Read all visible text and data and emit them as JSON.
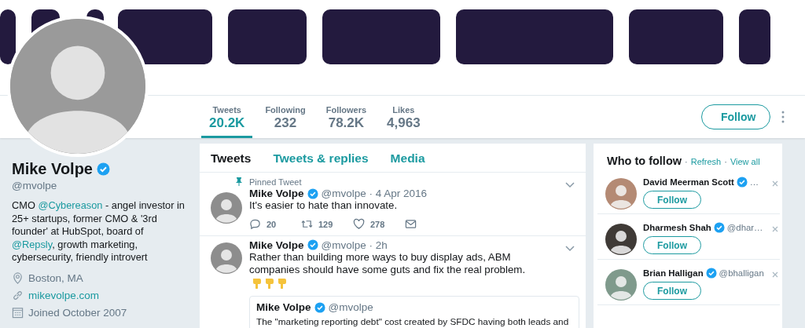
{
  "stats": [
    {
      "label": "Tweets",
      "value": "20.2K",
      "selected": true
    },
    {
      "label": "Following",
      "value": "232",
      "selected": false
    },
    {
      "label": "Followers",
      "value": "78.2K",
      "selected": false
    },
    {
      "label": "Likes",
      "value": "4,963",
      "selected": false
    }
  ],
  "follow_button": "Follow",
  "profile": {
    "name": "Mike Volpe",
    "verified": true,
    "handle": "@mvolpe",
    "bio": [
      {
        "text": "CMO ",
        "kind": "plain"
      },
      {
        "text": "@Cybereason",
        "kind": "link"
      },
      {
        "text": " - angel investor in 25+ startups, former CMO & '3rd founder' at HubSpot, board of ",
        "kind": "plain"
      },
      {
        "text": "@Repsly",
        "kind": "link"
      },
      {
        "text": ", growth marketing, cybersecurity, friendly introvert",
        "kind": "plain"
      }
    ],
    "details": [
      {
        "kind": "location",
        "text": "Boston, MA"
      },
      {
        "kind": "link",
        "text": "mikevolpe.com"
      },
      {
        "kind": "joined",
        "text": "Joined October 2007"
      }
    ]
  },
  "tabs": [
    {
      "label": "Tweets",
      "selected": true
    },
    {
      "label": "Tweets & replies",
      "selected": false
    },
    {
      "label": "Media",
      "selected": false
    }
  ],
  "tweets": [
    {
      "pinned_label": "Pinned Tweet",
      "name": "Mike Volpe",
      "verified": true,
      "meta": "@mvolpe · 4 Apr 2016",
      "text": "It's easier to hate than innovate.",
      "emoji_hands": false,
      "actions": {
        "replies": "20",
        "retweets": "129",
        "likes": "278"
      }
    },
    {
      "name": "Mike Volpe",
      "verified": true,
      "meta": "@mvolpe · 2h",
      "text": "Rather than building more ways to buy display ads, ABM companies should have some guts and fix the real problem.",
      "emoji_hands": true,
      "quote": {
        "name": "Mike Volpe",
        "verified": true,
        "handle": "@mvolpe",
        "text": "The \"marketing reporting debt\" cost created by SFDC having both leads and"
      }
    }
  ],
  "who_to_follow": {
    "title": "Who to follow",
    "links": [
      {
        "sep": "·",
        "label": "Refresh"
      },
      {
        "sep": "·",
        "label": "View all"
      }
    ],
    "items": [
      {
        "name": "David Meerman Scott",
        "verified": true,
        "handle": "…",
        "button": "Follow"
      },
      {
        "name": "Dharmesh Shah",
        "verified": true,
        "handle": "@dhar…",
        "button": "Follow"
      },
      {
        "name": "Brian Halligan",
        "verified": true,
        "handle": "@bhalligan",
        "button": "Follow"
      }
    ]
  }
}
